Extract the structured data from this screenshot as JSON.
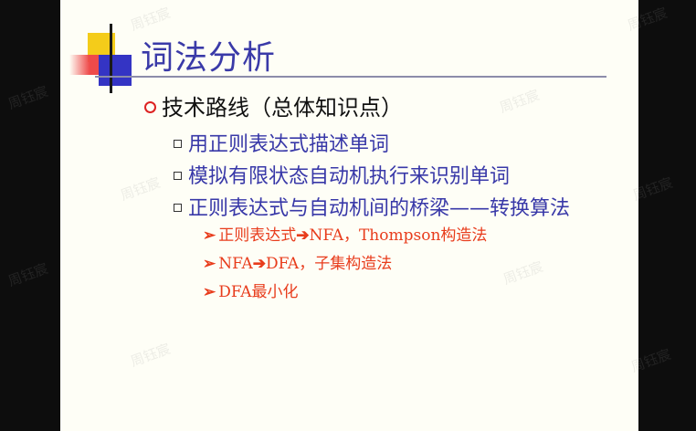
{
  "slide": {
    "title": "词法分析",
    "level1": {
      "text": "技术路线（总体知识点）"
    },
    "level2": [
      {
        "text": "用正则表达式描述单词"
      },
      {
        "text": "模拟有限状态自动机执行来识别单词"
      },
      {
        "text": "正则表达式与自动机间的桥梁——转换算法"
      }
    ],
    "level3": [
      {
        "before": "正则表达式",
        "after": "NFA，Thompson构造法"
      },
      {
        "before": "NFA",
        "after": "DFA，子集构造法"
      },
      {
        "before": "DFA最小化",
        "after": ""
      }
    ],
    "arrow_glyph": "➢",
    "mid_arrow_glyph": "➔"
  },
  "watermark": "周钰宸",
  "colors": {
    "title": "#3a3aa8",
    "level2": "#3838a8",
    "level3": "#e83c1c",
    "slide_bg": "#fefef6"
  }
}
